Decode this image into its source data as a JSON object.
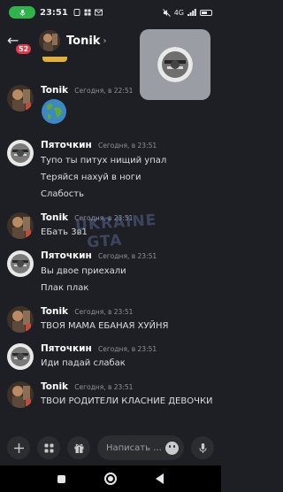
{
  "status_bar": {
    "time": "23:51",
    "network": "4G",
    "signal_label": "📶"
  },
  "header": {
    "badge_count": "52",
    "channel_name": "Tonik",
    "chevron": "›"
  },
  "messages": [
    {
      "author": "Tonik",
      "time": "Сегодня, в 22:51",
      "lines": [],
      "attachment": "globe-emoji"
    },
    {
      "author": "Пяточкин",
      "time": "Сегодня, в 23:51",
      "lines": [
        "Тупо ты питух нищий упал",
        "Теряйся нахуй в ноги",
        "Слабость"
      ]
    },
    {
      "author": "Tonik",
      "time": "Сегодня, в 23:51",
      "lines": [
        "ЕБать 3в1"
      ]
    },
    {
      "author": "Пяточкин",
      "time": "Сегодня, в 23:51",
      "lines": [
        "Вы двое приехали",
        "Плак плак"
      ]
    },
    {
      "author": "Tonik",
      "time": "Сегодня, в 23:51",
      "lines": [
        "ТВОЯ МАМА ЕБАНАЯ ХУЙНЯ"
      ]
    },
    {
      "author": "Пяточкин",
      "time": "Сегодня, в 23:51",
      "lines": [
        "Иди падай слабак"
      ]
    },
    {
      "author": "Tonik",
      "time": "Сегодня, в 23:51",
      "lines": [
        "ТВОИ РОДИТЕЛИ КЛАСНИЕ ДЕВОЧКИ"
      ]
    }
  ],
  "watermark": {
    "line1": "UKRAINE",
    "line2": "GTA"
  },
  "composer": {
    "placeholder": "Написать ..."
  },
  "colors": {
    "background": "#1e1f24",
    "mic_active": "#2fb34a",
    "badge": "#e0394a",
    "input_bg": "#2b2d31"
  }
}
